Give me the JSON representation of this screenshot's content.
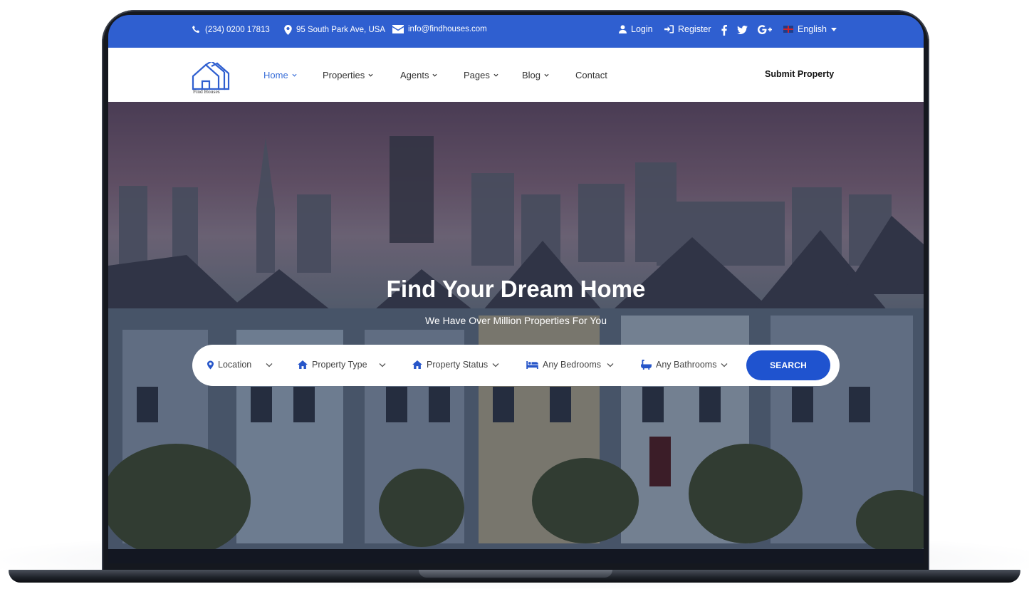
{
  "topbar": {
    "phone": "(234) 0200 17813",
    "address": "95 South Park Ave, USA",
    "email": "info@findhouses.com",
    "login": "Login",
    "register": "Register",
    "language": "English"
  },
  "logo": {
    "text": "Find Houses"
  },
  "nav": {
    "home": "Home",
    "properties": "Properties",
    "agents": "Agents",
    "pages": "Pages",
    "blog": "Blog",
    "contact": "Contact",
    "submit": "Submit Property"
  },
  "hero": {
    "title": "Find Your Dream Home",
    "subtitle": "We Have Over Million Properties For You"
  },
  "search": {
    "location": "Location",
    "property_type": "Property Type",
    "property_status": "Property Status",
    "bedrooms": "Any Bedrooms",
    "bathrooms": "Any Bathrooms",
    "button": "SEARCH"
  },
  "colors": {
    "topbar": "#2f5fd0",
    "accent": "#1f53cf",
    "nav_active": "#3a6fd8"
  }
}
